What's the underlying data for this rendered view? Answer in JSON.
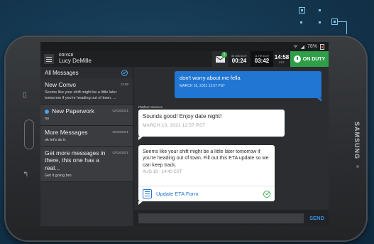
{
  "status_bar": {
    "battery": "78%"
  },
  "appbar": {
    "driver_label": "DRIVER",
    "driver_name": "Lucy DeMille",
    "unread_count": "3",
    "timer1_label": "30 MIN DOT",
    "timer1_value": "00:24",
    "timer2_label": "11 HR DOT",
    "timer2_value": "03:42",
    "clock": "14:58",
    "timezone": "PST",
    "duty_status": "ON DUTY"
  },
  "sidebar": {
    "header": "All Messages",
    "conversations": [
      {
        "title": "New Convo",
        "time": "12:58",
        "preview": "Seems like your shift might be a little later tomorrow if you're heading out of town. ...",
        "unread": false
      },
      {
        "title": "New Paperwork",
        "time": "02/18/2021",
        "preview": "no",
        "unread": true
      },
      {
        "title": "More Messages",
        "time": "02/18/2021",
        "preview": "ok let's do it.",
        "unread": false
      },
      {
        "title": "Get more messages in there, this one has a real...",
        "time": "02/18/2021",
        "preview": "Get it going bro.",
        "unread": false
      }
    ]
  },
  "chat": {
    "outgoing": {
      "text": "don't worry about me fella",
      "date": "MARCH 10, 2021 12:57 PST"
    },
    "sender": "Platform Science",
    "incoming1": {
      "text": "Sounds good!  Enjoy date night!",
      "date": "MARCH 10, 2021 12:57 PST"
    },
    "incoming2": {
      "text": "Seems like your shift might be a little later tomorrow if you're heading out of town. Fill out this ETA update so we can keep track.",
      "date": "AUG 18 - 14:40 CST",
      "form_label": "Update ETA Form"
    }
  },
  "composer": {
    "value": "",
    "send_label": "SEND"
  },
  "device": {
    "brand": "SAMSUNG"
  },
  "colors": {
    "accent": "#2176d4",
    "duty_green": "#2f9e48",
    "unread_dot": "#4aa3e6"
  }
}
